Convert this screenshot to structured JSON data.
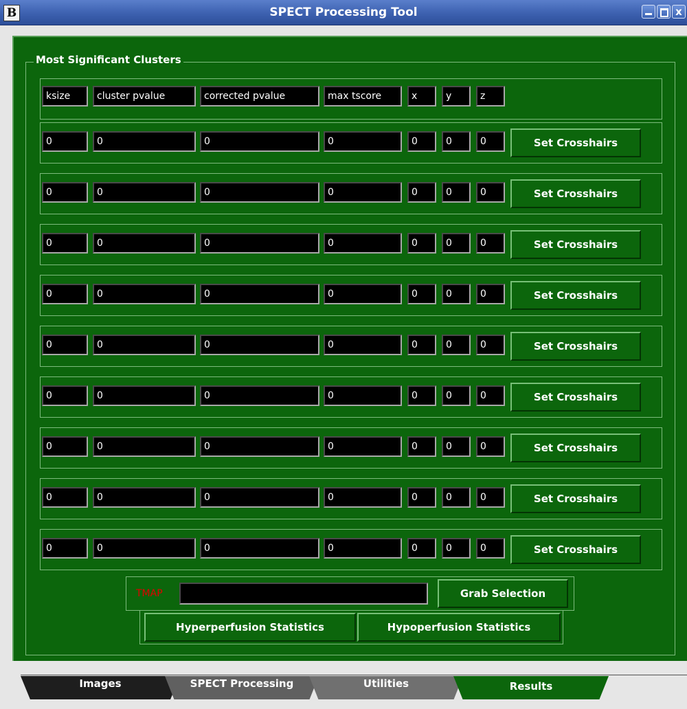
{
  "window": {
    "app_icon_letter": "B",
    "title": "SPECT Processing Tool",
    "controls": {
      "minimize": "_",
      "maximize": "□",
      "close": "x"
    }
  },
  "clusters": {
    "group_label": "Most Significant Clusters",
    "headers": [
      "ksize",
      "cluster pvalue",
      "corrected pvalue",
      "max tscore",
      "x",
      "y",
      "z"
    ],
    "rows": [
      {
        "ksize": "0",
        "cluster_pvalue": "0",
        "corrected_pvalue": "0",
        "max_tscore": "0",
        "x": "0",
        "y": "0",
        "z": "0"
      },
      {
        "ksize": "0",
        "cluster_pvalue": "0",
        "corrected_pvalue": "0",
        "max_tscore": "0",
        "x": "0",
        "y": "0",
        "z": "0"
      },
      {
        "ksize": "0",
        "cluster_pvalue": "0",
        "corrected_pvalue": "0",
        "max_tscore": "0",
        "x": "0",
        "y": "0",
        "z": "0"
      },
      {
        "ksize": "0",
        "cluster_pvalue": "0",
        "corrected_pvalue": "0",
        "max_tscore": "0",
        "x": "0",
        "y": "0",
        "z": "0"
      },
      {
        "ksize": "0",
        "cluster_pvalue": "0",
        "corrected_pvalue": "0",
        "max_tscore": "0",
        "x": "0",
        "y": "0",
        "z": "0"
      },
      {
        "ksize": "0",
        "cluster_pvalue": "0",
        "corrected_pvalue": "0",
        "max_tscore": "0",
        "x": "0",
        "y": "0",
        "z": "0"
      },
      {
        "ksize": "0",
        "cluster_pvalue": "0",
        "corrected_pvalue": "0",
        "max_tscore": "0",
        "x": "0",
        "y": "0",
        "z": "0"
      },
      {
        "ksize": "0",
        "cluster_pvalue": "0",
        "corrected_pvalue": "0",
        "max_tscore": "0",
        "x": "0",
        "y": "0",
        "z": "0"
      },
      {
        "ksize": "0",
        "cluster_pvalue": "0",
        "corrected_pvalue": "0",
        "max_tscore": "0",
        "x": "0",
        "y": "0",
        "z": "0"
      }
    ],
    "set_crosshairs_label": "Set Crosshairs"
  },
  "tmap": {
    "label": "TMAP",
    "value": "",
    "grab_label": "Grab Selection"
  },
  "stats": {
    "hyper_label": "Hyperperfusion Statistics",
    "hypo_label": "Hypoperfusion Statistics"
  },
  "tabs": [
    {
      "label": "Images"
    },
    {
      "label": "SPECT Processing"
    },
    {
      "label": "Utilities"
    },
    {
      "label": "Results",
      "active": true
    }
  ],
  "colors": {
    "panel_green": "#0c660c",
    "titlebar_blue": "#3f63b2",
    "tmap_red": "#e00000"
  }
}
